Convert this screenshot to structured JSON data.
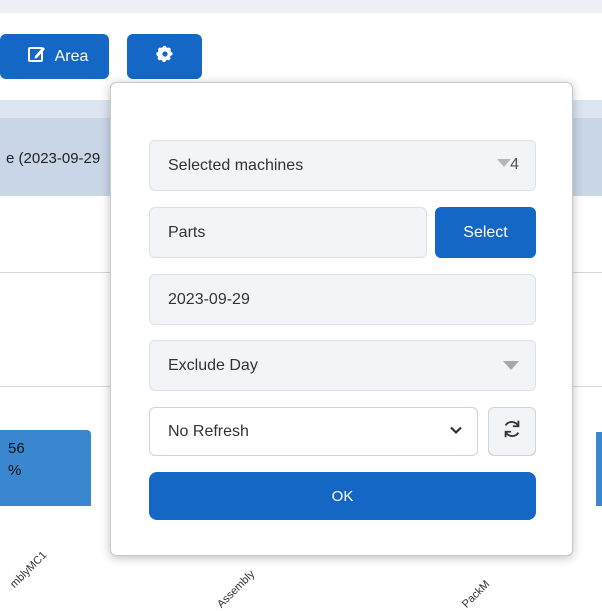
{
  "toolbar": {
    "area_label": "Area",
    "edit_icon": "edit-icon",
    "gear_icon": "gear-icon"
  },
  "background": {
    "row_text": "e (2023-09-29",
    "bar_value_1": "56",
    "bar_value_2": "%",
    "x_labels": [
      "mblyMC1",
      "Assembly",
      "PackM"
    ]
  },
  "popup": {
    "machines_label": "Selected machines",
    "machines_count": "4",
    "parts_value": "Parts",
    "select_label": "Select",
    "date_value": "2023-09-29",
    "exclude_value": "Exclude Day",
    "refresh_value": "No Refresh",
    "refresh_options": [
      "No Refresh"
    ],
    "ok_label": "OK",
    "sync_icon": "refresh-icon"
  },
  "colors": {
    "accent": "#1467c4",
    "bar": "#3a86cf",
    "field_bg": "#f2f4f7"
  }
}
